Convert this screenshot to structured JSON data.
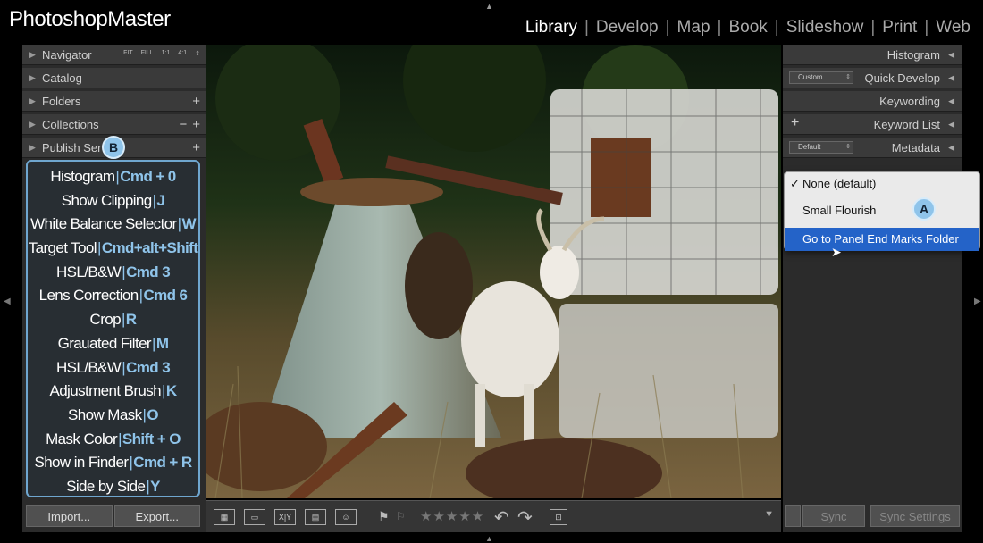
{
  "brand": {
    "logo_text": "PhotoshopMaster"
  },
  "modules": [
    {
      "label": "Library",
      "active": true
    },
    {
      "label": "Develop"
    },
    {
      "label": "Map"
    },
    {
      "label": "Book"
    },
    {
      "label": "Slideshow"
    },
    {
      "label": "Print"
    },
    {
      "label": "Web"
    }
  ],
  "left_panel": {
    "headers": [
      {
        "label": "Navigator"
      },
      {
        "label": "Catalog"
      },
      {
        "label": "Folders"
      },
      {
        "label": "Collections"
      },
      {
        "label": "Publish Ser"
      }
    ],
    "navigator_options": [
      "FIT",
      "FILL",
      "1:1",
      "4:1"
    ],
    "badge_b": "B",
    "buttons": {
      "import": "Import...",
      "export": "Export..."
    }
  },
  "shortcuts": [
    {
      "name": "Histogram",
      "key": "Cmd + 0"
    },
    {
      "name": "Show Clipping",
      "key": "J"
    },
    {
      "name": "White Balance Selector",
      "key": "W"
    },
    {
      "name": "Target Tool",
      "key": "Cmd+alt+Shift"
    },
    {
      "name": "HSL/B&W",
      "key": "Cmd 3"
    },
    {
      "name": "Lens Correction",
      "key": "Cmd 6"
    },
    {
      "name": "Crop",
      "key": "R"
    },
    {
      "name": "Grauated Filter",
      "key": "M"
    },
    {
      "name": "HSL/B&W",
      "key": "Cmd 3"
    },
    {
      "name": "Adjustment Brush",
      "key": "K"
    },
    {
      "name": "Show Mask",
      "key": "O"
    },
    {
      "name": "Mask Color",
      "key": "Shift + O"
    },
    {
      "name": "Show in Finder",
      "key": "Cmd + R"
    },
    {
      "name": "Side by Side",
      "key": "Y"
    }
  ],
  "right_panel": {
    "headers": [
      {
        "label": "Histogram"
      },
      {
        "label": "Quick Develop",
        "preset": "Custom"
      },
      {
        "label": "Keywording"
      },
      {
        "label": "Keyword List"
      },
      {
        "label": "Metadata",
        "preset": "Default"
      }
    ],
    "menu": {
      "items": [
        {
          "label": "None (default)",
          "checked": true
        },
        {
          "label": "Small Flourish"
        },
        {
          "label": "Go to Panel End Marks Folder",
          "selected": true
        }
      ],
      "badge_a": "A"
    },
    "buttons": {
      "sync": "Sync",
      "sync_settings": "Sync Settings"
    }
  },
  "toolbar": {
    "view_icons": [
      "grid-view-icon",
      "loupe-view-icon",
      "compare-view-icon",
      "survey-view-icon",
      "people-view-icon"
    ],
    "compare_label": "X|Y",
    "stars": "★★★★★"
  },
  "colors": {
    "accent": "#8fc4ea",
    "menu_selection": "#2463c8",
    "panel_bg": "#2b2b2b",
    "panel_header": "#3a3a3a"
  }
}
